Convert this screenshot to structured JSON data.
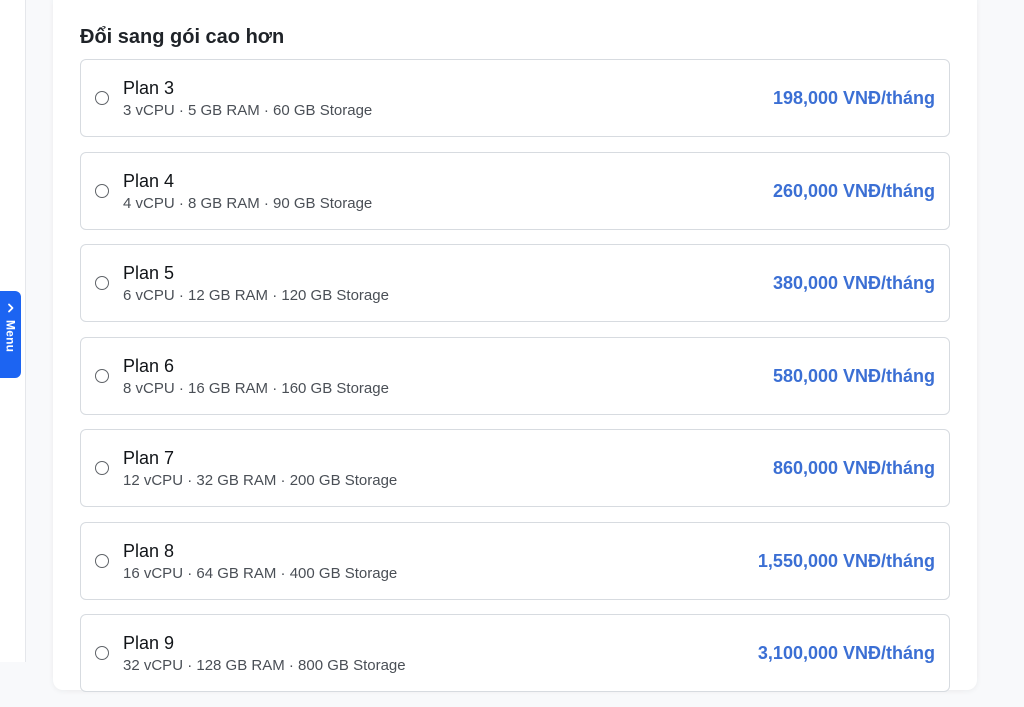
{
  "sidebar": {
    "menu_label": "Menu",
    "menu_icon": "chevron-right-icon"
  },
  "section": {
    "title": "Đổi sang gói cao hơn"
  },
  "colors": {
    "accent": "#1c64f2",
    "price": "#3b6fd4"
  },
  "plans": [
    {
      "name": "Plan 3",
      "specs": "3 vCPU · 5 GB RAM · 60 GB Storage",
      "price": "198,000 VNĐ/tháng"
    },
    {
      "name": "Plan 4",
      "specs": "4 vCPU · 8 GB RAM · 90 GB Storage",
      "price": "260,000 VNĐ/tháng"
    },
    {
      "name": "Plan 5",
      "specs": "6 vCPU · 12 GB RAM · 120 GB Storage",
      "price": "380,000 VNĐ/tháng"
    },
    {
      "name": "Plan 6",
      "specs": "8 vCPU · 16 GB RAM · 160 GB Storage",
      "price": "580,000 VNĐ/tháng"
    },
    {
      "name": "Plan 7",
      "specs": "12 vCPU · 32 GB RAM · 200 GB Storage",
      "price": "860,000 VNĐ/tháng"
    },
    {
      "name": "Plan 8",
      "specs": "16 vCPU · 64 GB RAM · 400 GB Storage",
      "price": "1,550,000 VNĐ/tháng"
    },
    {
      "name": "Plan 9",
      "specs": "32 vCPU · 128 GB RAM · 800 GB Storage",
      "price": "3,100,000 VNĐ/tháng"
    }
  ]
}
